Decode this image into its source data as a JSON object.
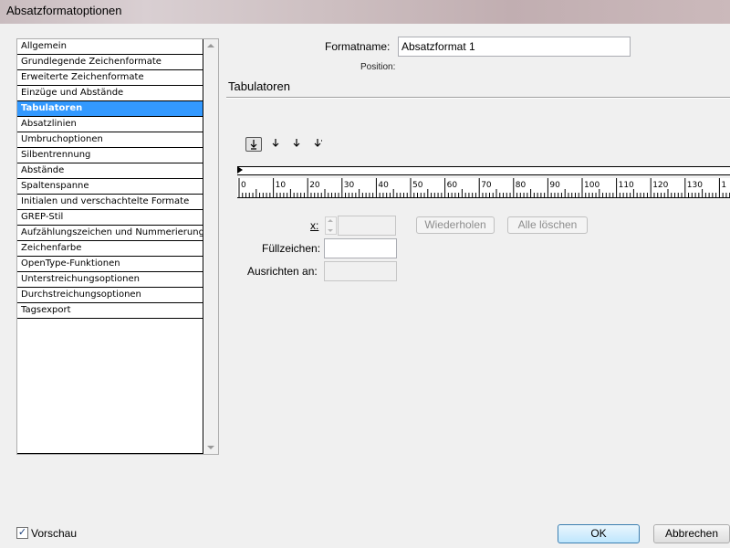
{
  "window": {
    "title": "Absatzformatoptionen"
  },
  "categories": [
    "Allgemein",
    "Grundlegende Zeichenformate",
    "Erweiterte Zeichenformate",
    "Einzüge und Abstände",
    "Tabulatoren",
    "Absatzlinien",
    "Umbruchoptionen",
    "Silbentrennung",
    "Abstände",
    "Spaltenspanne",
    "Initialen und verschachtelte Formate",
    "GREP-Stil",
    "Aufzählungszeichen und Nummerierung",
    "Zeichenfarbe",
    "OpenType-Funktionen",
    "Unterstreichungsoptionen",
    "Durchstreichungsoptionen",
    "Tagsexport"
  ],
  "selected_category": "Tabulatoren",
  "format": {
    "name_label": "Formatname:",
    "name_value": "Absatzformat 1",
    "position_label": "Position:"
  },
  "section": {
    "title": "Tabulatoren"
  },
  "tab_buttons": [
    "left-tab-icon",
    "center-tab-icon",
    "right-tab-icon",
    "decimal-tab-icon"
  ],
  "ruler": {
    "labels": [
      "0",
      "10",
      "20",
      "30",
      "40",
      "50",
      "60",
      "70",
      "80",
      "90",
      "100",
      "110",
      "120",
      "130",
      "1"
    ]
  },
  "fields": {
    "x_label": "x:",
    "x_value": "",
    "fill_label": "Füllzeichen:",
    "fill_value": "",
    "align_label": "Ausrichten an:",
    "align_value": ""
  },
  "buttons": {
    "repeat": "Wiederholen",
    "clear_all": "Alle löschen",
    "ok": "OK",
    "cancel": "Abbrechen"
  },
  "preview": {
    "label": "Vorschau",
    "checked": true
  }
}
